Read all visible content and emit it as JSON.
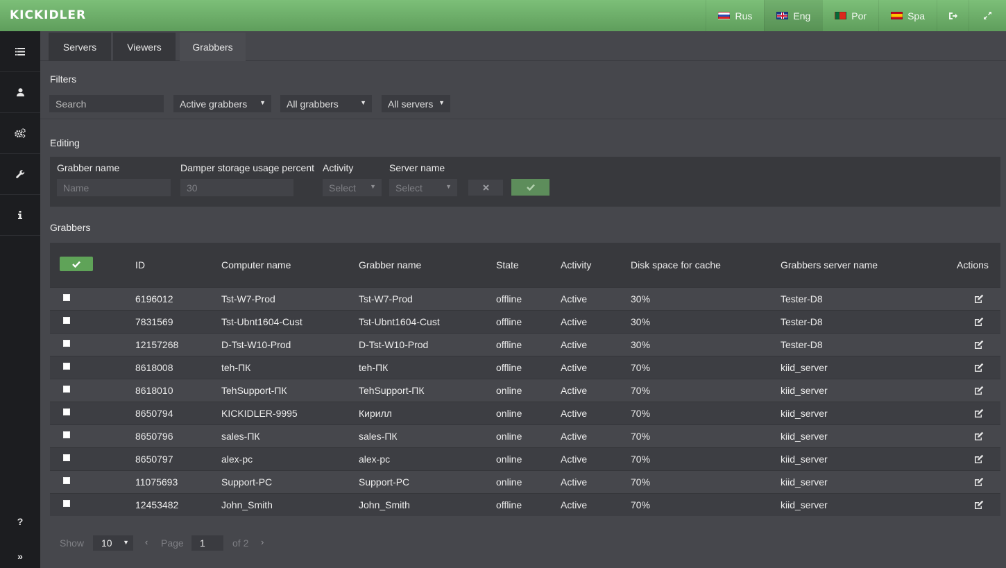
{
  "app": {
    "logo": "KICKIDLER"
  },
  "languages": [
    {
      "label": "Rus",
      "flag": "ru"
    },
    {
      "label": "Eng",
      "flag": "en",
      "active": true
    },
    {
      "label": "Por",
      "flag": "pt"
    },
    {
      "label": "Spa",
      "flag": "es"
    }
  ],
  "topbar_icons": [
    "logout-icon",
    "fullscreen-icon"
  ],
  "sidebar": {
    "items": [
      "list-icon",
      "user-icon",
      "gears-icon",
      "wrench-icon",
      "info-icon"
    ],
    "bottom": {
      "help": "?",
      "expand": "»"
    }
  },
  "tabs": [
    "Servers",
    "Viewers",
    "Grabbers"
  ],
  "active_tab": "Grabbers",
  "filters": {
    "title": "Filters",
    "search_placeholder": "Search",
    "state": "Active grabbers",
    "type": "All grabbers",
    "server": "All servers"
  },
  "editing": {
    "title": "Editing",
    "labels": {
      "grabber_name": "Grabber name",
      "damper": "Damper storage usage percent",
      "activity": "Activity",
      "server_name": "Server name"
    },
    "name_placeholder": "Name",
    "damper_placeholder": "30",
    "activity_select": "Select",
    "server_select": "Select"
  },
  "grabbers": {
    "title": "Grabbers",
    "columns": {
      "id": "ID",
      "computer": "Computer name",
      "grabber": "Grabber name",
      "state": "State",
      "activity": "Activity",
      "disk": "Disk space for cache",
      "server": "Grabbers server name",
      "actions": "Actions"
    },
    "rows": [
      {
        "id": "6196012",
        "computer": "Tst-W7-Prod",
        "grabber": "Tst-W7-Prod",
        "state": "offline",
        "activity": "Active",
        "disk": "30%",
        "server": "Tester-D8"
      },
      {
        "id": "7831569",
        "computer": "Tst-Ubnt1604-Cust",
        "grabber": "Tst-Ubnt1604-Cust",
        "state": "offline",
        "activity": "Active",
        "disk": "30%",
        "server": "Tester-D8"
      },
      {
        "id": "12157268",
        "computer": "D-Tst-W10-Prod",
        "grabber": "D-Tst-W10-Prod",
        "state": "offline",
        "activity": "Active",
        "disk": "30%",
        "server": "Tester-D8"
      },
      {
        "id": "8618008",
        "computer": "teh-ПК",
        "grabber": "teh-ПК",
        "state": "offline",
        "activity": "Active",
        "disk": "70%",
        "server": "kiid_server"
      },
      {
        "id": "8618010",
        "computer": "TehSupport-ПК",
        "grabber": "TehSupport-ПК",
        "state": "online",
        "activity": "Active",
        "disk": "70%",
        "server": "kiid_server"
      },
      {
        "id": "8650794",
        "computer": "KICKIDLER-9995",
        "grabber": "Кирилл",
        "state": "online",
        "activity": "Active",
        "disk": "70%",
        "server": "kiid_server"
      },
      {
        "id": "8650796",
        "computer": "sales-ПК",
        "grabber": "sales-ПК",
        "state": "online",
        "activity": "Active",
        "disk": "70%",
        "server": "kiid_server"
      },
      {
        "id": "8650797",
        "computer": "alex-pc",
        "grabber": "alex-pc",
        "state": "online",
        "activity": "Active",
        "disk": "70%",
        "server": "kiid_server"
      },
      {
        "id": "11075693",
        "computer": "Support-PC",
        "grabber": "Support-PC",
        "state": "online",
        "activity": "Active",
        "disk": "70%",
        "server": "kiid_server"
      },
      {
        "id": "12453482",
        "computer": "John_Smith",
        "grabber": "John_Smith",
        "state": "offline",
        "activity": "Active",
        "disk": "70%",
        "server": "kiid_server"
      }
    ]
  },
  "pagination": {
    "show_label": "Show",
    "per_page": "10",
    "page_label": "Page",
    "page": "1",
    "of_label": "of 2",
    "prev": "‹",
    "next": "›"
  },
  "colors": {
    "accent_green": "#6fb36a",
    "background": "#46474c",
    "sidebar": "#1c1d20"
  }
}
